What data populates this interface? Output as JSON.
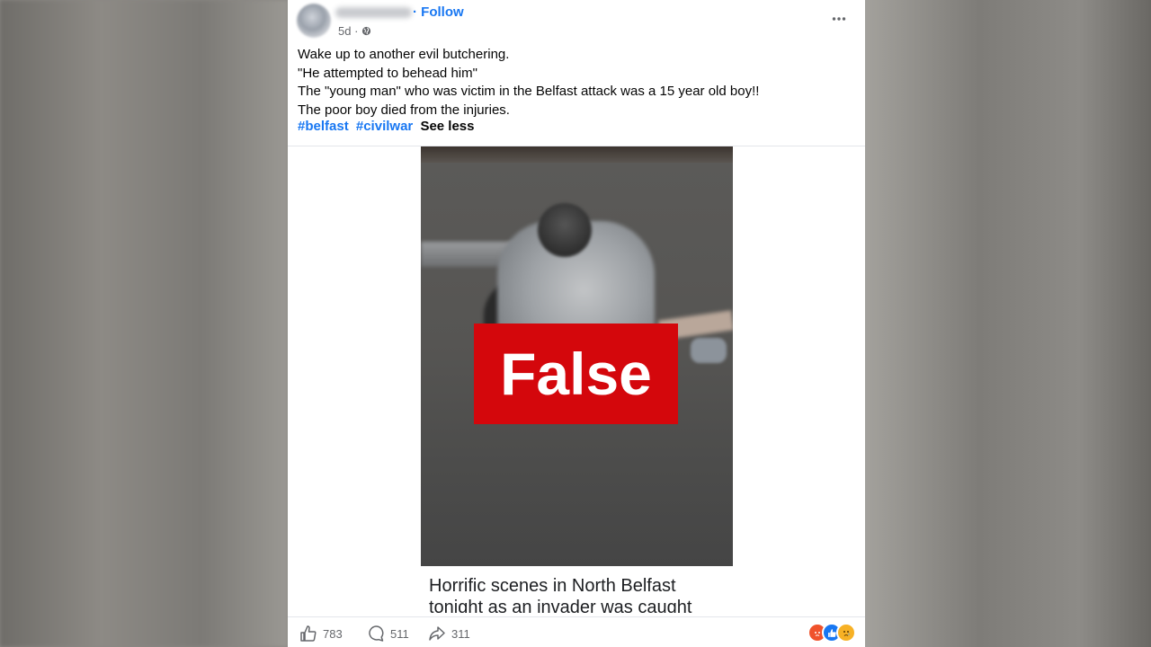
{
  "post": {
    "follow_label": "· Follow",
    "time": "5d ·",
    "lines": [
      "Wake up to another evil butchering.",
      "\"He attempted to behead him\"",
      "The \"young man\" who was victim in the Belfast attack was a 15 year old boy!!",
      "The poor boy died from the injuries."
    ],
    "hashtags": [
      "#belfast",
      "#civilwar"
    ],
    "see_less": "See less",
    "badge_label": "False",
    "caption": "Horrific scenes in North Belfast tonight as an invader was caught"
  },
  "actions": {
    "likes": "783",
    "comments": "511",
    "shares": "311"
  },
  "icons": {
    "globe": "globe-icon",
    "more": "more-options-icon",
    "like": "thumbs-up-icon",
    "comment": "comment-icon",
    "share": "share-icon"
  },
  "colors": {
    "accent": "#1877f2",
    "false_badge": "#d4070c",
    "angry": "#f0522b",
    "like": "#1877f2",
    "sad": "#f7b125"
  }
}
